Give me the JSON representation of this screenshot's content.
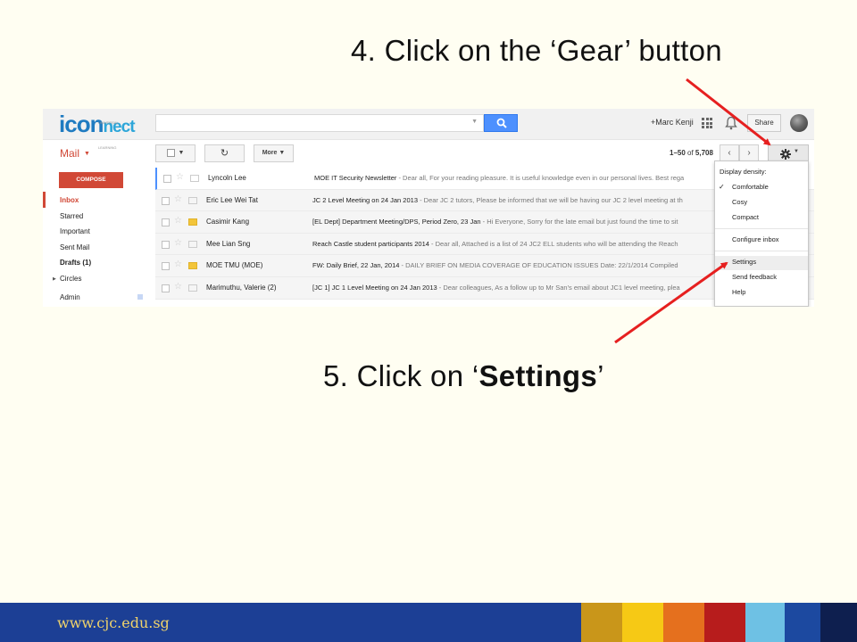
{
  "step4": "4. Click on the ‘Gear’ button",
  "step5": {
    "prefix": "5. Click on ‘",
    "bold": "Settings",
    "suffix": "’"
  },
  "gmail": {
    "logo": {
      "ic": "ic",
      "on": "on",
      "nect": "nect",
      "tiny": "UNIVERSAL LEARNING"
    },
    "search_placeholder": "",
    "user": "+Marc Kenji",
    "share_label": "Share",
    "mail_label": "Mail",
    "toolbar": {
      "refresh": "↻",
      "more_label": "More"
    },
    "count": {
      "range": "1–50",
      "of": " of ",
      "total": "5,708"
    },
    "compose_label": "COMPOSE",
    "nav": [
      "Inbox",
      "Starred",
      "Important",
      "Sent Mail",
      "Drafts (1)",
      "Circles",
      "Admin"
    ],
    "rows": [
      {
        "sender": "Lyncoln Lee",
        "subject": "MOE IT Security Newsletter",
        "snippet": " - Dear all, For your reading pleasure. It is useful knowledge even in our personal lives. Best rega"
      },
      {
        "sender": "Eric Lee Wei Tat",
        "subject": "JC 2 Level Meeting on 24 Jan 2013",
        "snippet": " - Dear JC 2 tutors, Please be informed that we will be having our JC 2 level meeting at th"
      },
      {
        "sender": "Casimir Kang",
        "subject": "[EL Dept] Department Meeting/DPS, Period Zero, 23 Jan",
        "snippet": " - Hi Everyone, Sorry for the late email but just found the time to sit"
      },
      {
        "sender": "Mee Lian Sng",
        "subject": "Reach Castle student participants 2014",
        "snippet": " - Dear all, Attached is a list of 24 JC2 ELL students who will be attending the Reach"
      },
      {
        "sender": "MOE TMU (MOE)",
        "subject": "FW: Daily Brief, 22 Jan, 2014",
        "snippet": " - DAILY BRIEF ON MEDIA COVERAGE OF EDUCATION ISSUES Date: 22/1/2014 Compiled"
      },
      {
        "sender": "Marimuthu, Valerie (2)",
        "subject": "[JC 1] JC 1 Level Meeting on 24 Jan 2013",
        "snippet": " - Dear colleagues, As a follow up to Mr San's email about JC1 level meeting, plea"
      }
    ],
    "menu": {
      "density_label": "Display density:",
      "comfortable": "Comfortable",
      "check": "✓",
      "cosy": "Cosy",
      "compact": "Compact",
      "configure": "Configure inbox",
      "settings": "Settings",
      "feedback": "Send feedback",
      "help": "Help"
    }
  },
  "footer_url": "www.cjc.edu.sg",
  "colors": {
    "footer": "#1c3f95",
    "blocks": [
      "#c9961a",
      "#f6c915",
      "#e5701e",
      "#b71c1c",
      "#6ec1e4",
      "#1c49a0",
      "#0e1f4f"
    ],
    "arrow": "#e62020"
  }
}
